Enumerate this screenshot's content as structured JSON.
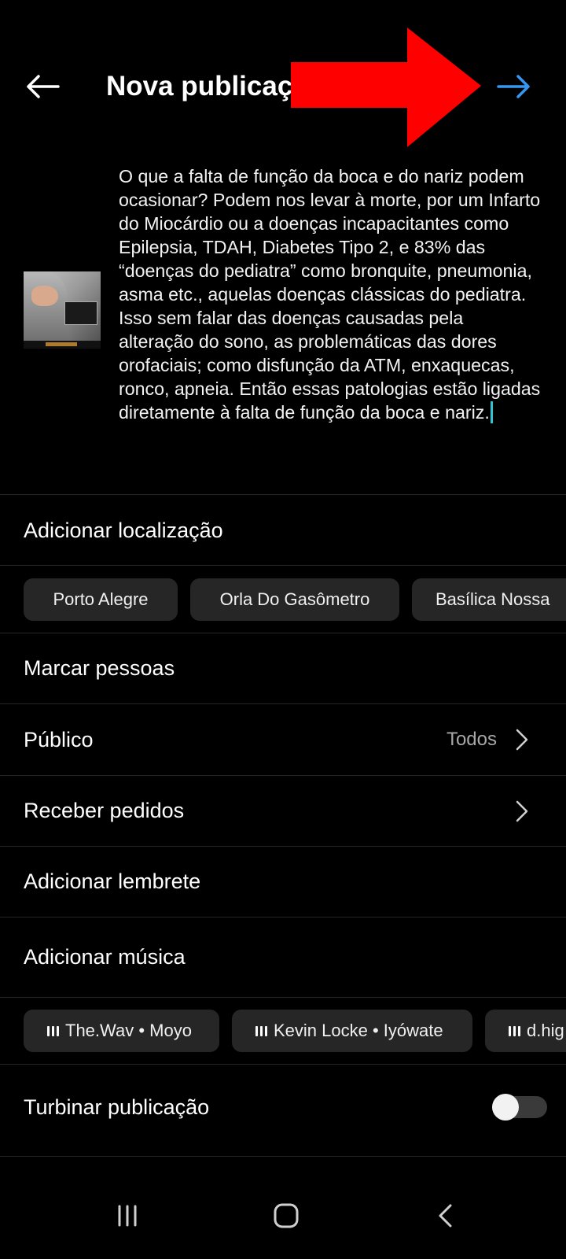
{
  "header": {
    "title": "Nova publicação"
  },
  "caption": {
    "text": "O que a falta de função da boca e do nariz podem ocasionar? Podem nos levar à morte, por um Infarto do Miocárdio ou a doenças incapacitantes como Epilepsia, TDAH, Diabetes Tipo 2, e 83% das “doenças do pediatra” como bronquite, pneumonia, asma etc., aquelas doenças clássicas do pediatra. Isso sem falar das doenças causadas pela alteração do sono, as problemáticas das dores orofaciais; como disfunção da ATM, enxaquecas, ronco, apneia. Então essas patologias estão ligadas diretamente à falta de função da boca e nariz."
  },
  "location": {
    "label": "Adicionar localização",
    "suggestions": [
      "Porto Alegre",
      "Orla Do Gasômetro",
      "Basílica Nossa"
    ]
  },
  "tag_people": {
    "label": "Marcar pessoas"
  },
  "audience": {
    "label": "Público",
    "value": "Todos"
  },
  "requests": {
    "label": "Receber pedidos"
  },
  "reminder": {
    "label": "Adicionar lembrete"
  },
  "music": {
    "label": "Adicionar música",
    "suggestions": [
      "The.Wav • Moyo",
      "Kevin Locke • Iyówate",
      "d.hig"
    ]
  },
  "boost": {
    "label": "Turbinar publicação",
    "enabled": false
  },
  "colors": {
    "accent_blue": "#3797f0",
    "annotation_red": "#ff0000"
  },
  "icons": {
    "back": "arrow-left-icon",
    "next": "arrow-right-icon",
    "chevron": "chevron-right-icon",
    "music": "music-bars-icon",
    "nav_recents": "recents-icon",
    "nav_home": "home-icon",
    "nav_back": "back-icon"
  }
}
